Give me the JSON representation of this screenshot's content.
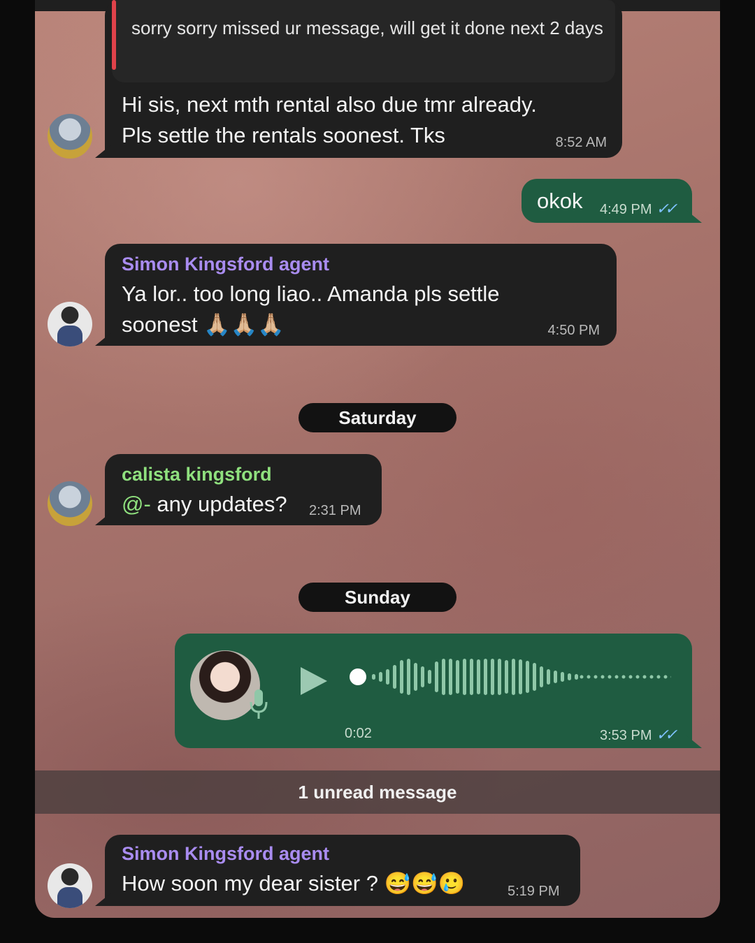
{
  "reply_preview": {
    "text": "sorry sorry missed ur message, will get it done next 2 days"
  },
  "messages": [
    {
      "text": "Hi sis, next mth rental also due tmr already. Pls settle the rentals soonest. Tks",
      "time": "8:52 AM"
    },
    {
      "text": "okok",
      "time": "4:49 PM",
      "ticks": "✓✓"
    },
    {
      "sender": "Simon Kingsford agent",
      "text": "Ya lor.. too long liao.. Amanda pls settle soonest 🙏🏼🙏🏼🙏🏼",
      "time": "4:50 PM"
    },
    {
      "sender": "calista kingsford",
      "mention": "@-",
      "text": " any updates?",
      "time": "2:31 PM"
    },
    {
      "duration": "0:02",
      "time": "3:53 PM",
      "ticks": "✓✓"
    },
    {
      "sender": "Simon Kingsford agent",
      "text": "How soon my dear sister ? 😅😅🥲",
      "time": "5:19 PM"
    }
  ],
  "date_separators": [
    "Saturday",
    "Sunday"
  ],
  "unread_banner": "1 unread message",
  "colors": {
    "incoming_bubble": "#1f1f1f",
    "outgoing_bubble": "#1f5c41",
    "sender_purple": "#a98cf0",
    "sender_green": "#8fe07e",
    "read_ticks": "#7fc3ff",
    "reply_bar": "#e0424a"
  }
}
